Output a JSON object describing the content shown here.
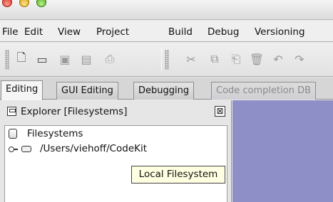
{
  "window": {
    "traffic_lights": [
      "close-icon",
      "minimize-icon",
      "zoom-icon"
    ]
  },
  "menubar": {
    "items": [
      "File",
      "Edit",
      "View",
      "Project",
      "Build",
      "Debug",
      "Versioning"
    ]
  },
  "toolbar": {
    "buttons": [
      "new-file-icon",
      "open-folder-icon",
      "save-icon",
      "save-all-icon",
      "print-icon",
      "cut-icon",
      "copy-icon",
      "paste-icon",
      "delete-icon",
      "undo-icon",
      "redo-icon"
    ]
  },
  "tabs": [
    {
      "label": "Editing",
      "selected": true
    },
    {
      "label": "GUI Editing",
      "selected": false
    },
    {
      "label": "Debugging",
      "selected": false
    },
    {
      "label": "Code completion DB",
      "selected": false
    }
  ],
  "explorer": {
    "title": "Explorer [Filesystems]",
    "close_glyph": "⊠",
    "tree": {
      "root_label": "Filesystems",
      "child_label": "/Users/viehoff/CodeKit"
    },
    "tooltip": "Local Filesystem"
  },
  "colors": {
    "editor_background": "#8d8fc6",
    "tooltip_background": "#ffffe1"
  }
}
